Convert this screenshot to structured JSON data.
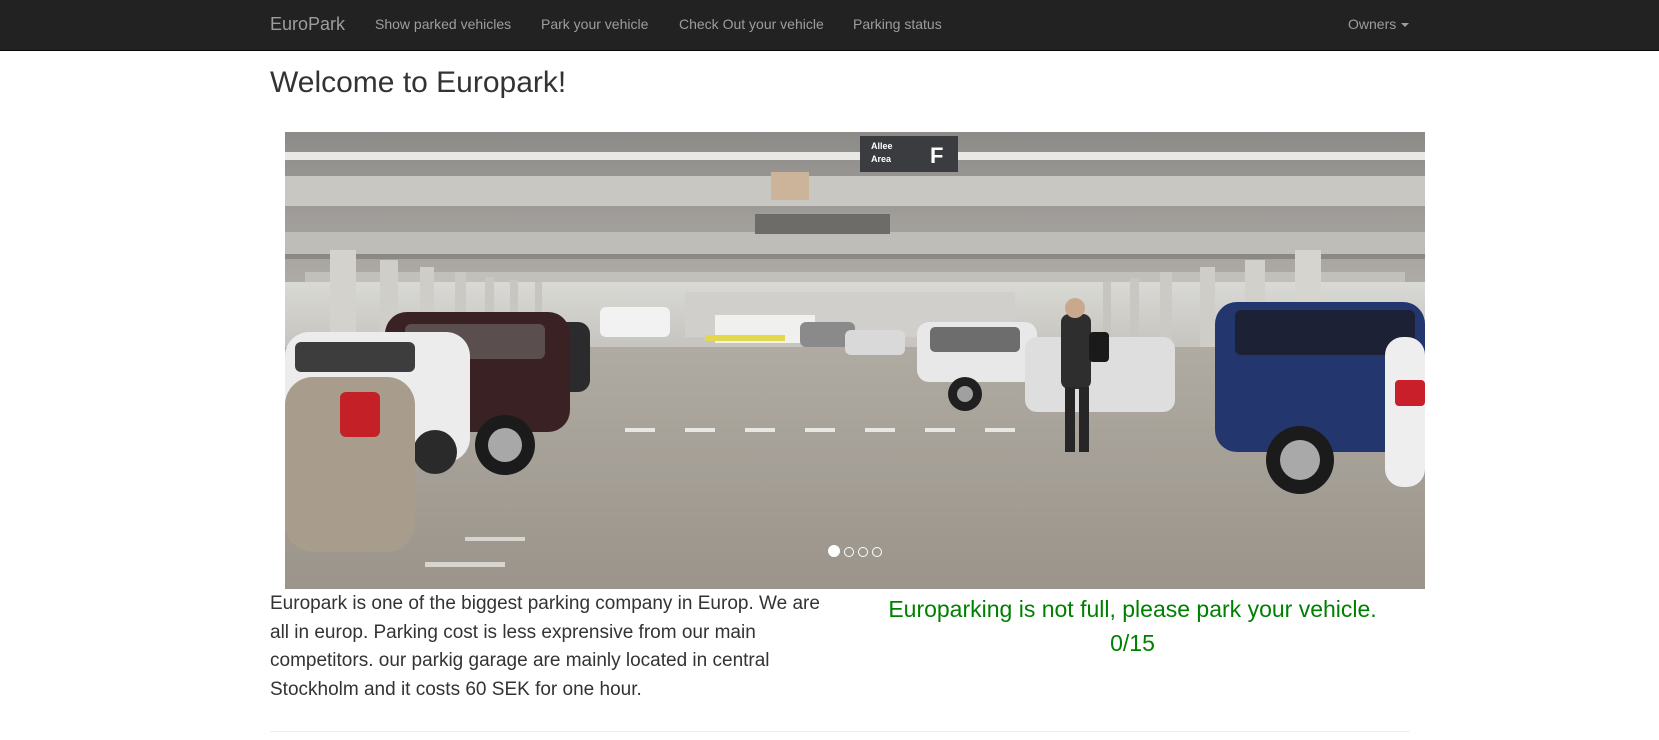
{
  "navbar": {
    "brand": "EuroPark",
    "links": [
      "Show parked vehicles",
      "Park your vehicle",
      "Check Out your vehicle",
      "Parking status"
    ],
    "owners_dropdown": "Owners"
  },
  "page": {
    "title": "Welcome to Europark!"
  },
  "carousel": {
    "slide_count": 4,
    "active_index": 0,
    "area_sign": {
      "line1": "Allee",
      "line2": "Area",
      "letter": "F"
    }
  },
  "about": {
    "text": "Europark is one of the biggest parking company in Europ. We are all in europ. Parking cost is less exprensive from our main competitors. our parkig garage are mainly located in central Stockholm and it costs 60 SEK for one hour."
  },
  "status": {
    "message": "Europarking is not full, please park your vehicle.",
    "count": "0/15",
    "color": "#008000"
  }
}
